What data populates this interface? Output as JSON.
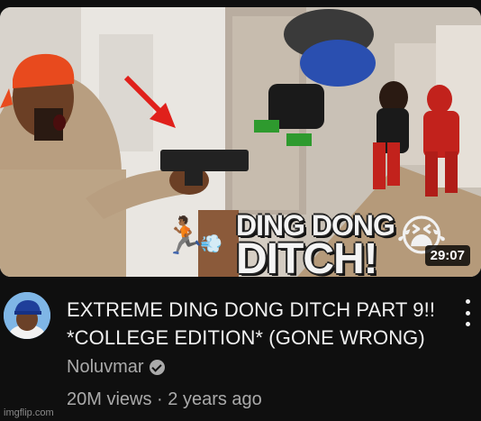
{
  "thumbnail": {
    "overlay_line1": "DING DONG",
    "overlay_line2": "DITCH!",
    "duration": "29:07",
    "emoji_runner": "🏃🏾",
    "emoji_dash": "💨",
    "emoji_crying": "😭"
  },
  "video": {
    "title_line1": "EXTREME DING DONG DITCH PART 9!!",
    "title_line2": "*COLLEGE EDITION* (GONE WRONG)",
    "channel": "Noluvmar",
    "views": "20M views",
    "separator": "·",
    "age": "2 years ago"
  },
  "watermark": "imgflip.com",
  "colors": {
    "background": "#0f0f0f",
    "primary_text": "#f1f1f1",
    "secondary_text": "#aaaaaa",
    "arrow": "#e0201b",
    "durag": "#e84a1e"
  },
  "icons": [
    "more-vert-icon",
    "verified-icon"
  ]
}
